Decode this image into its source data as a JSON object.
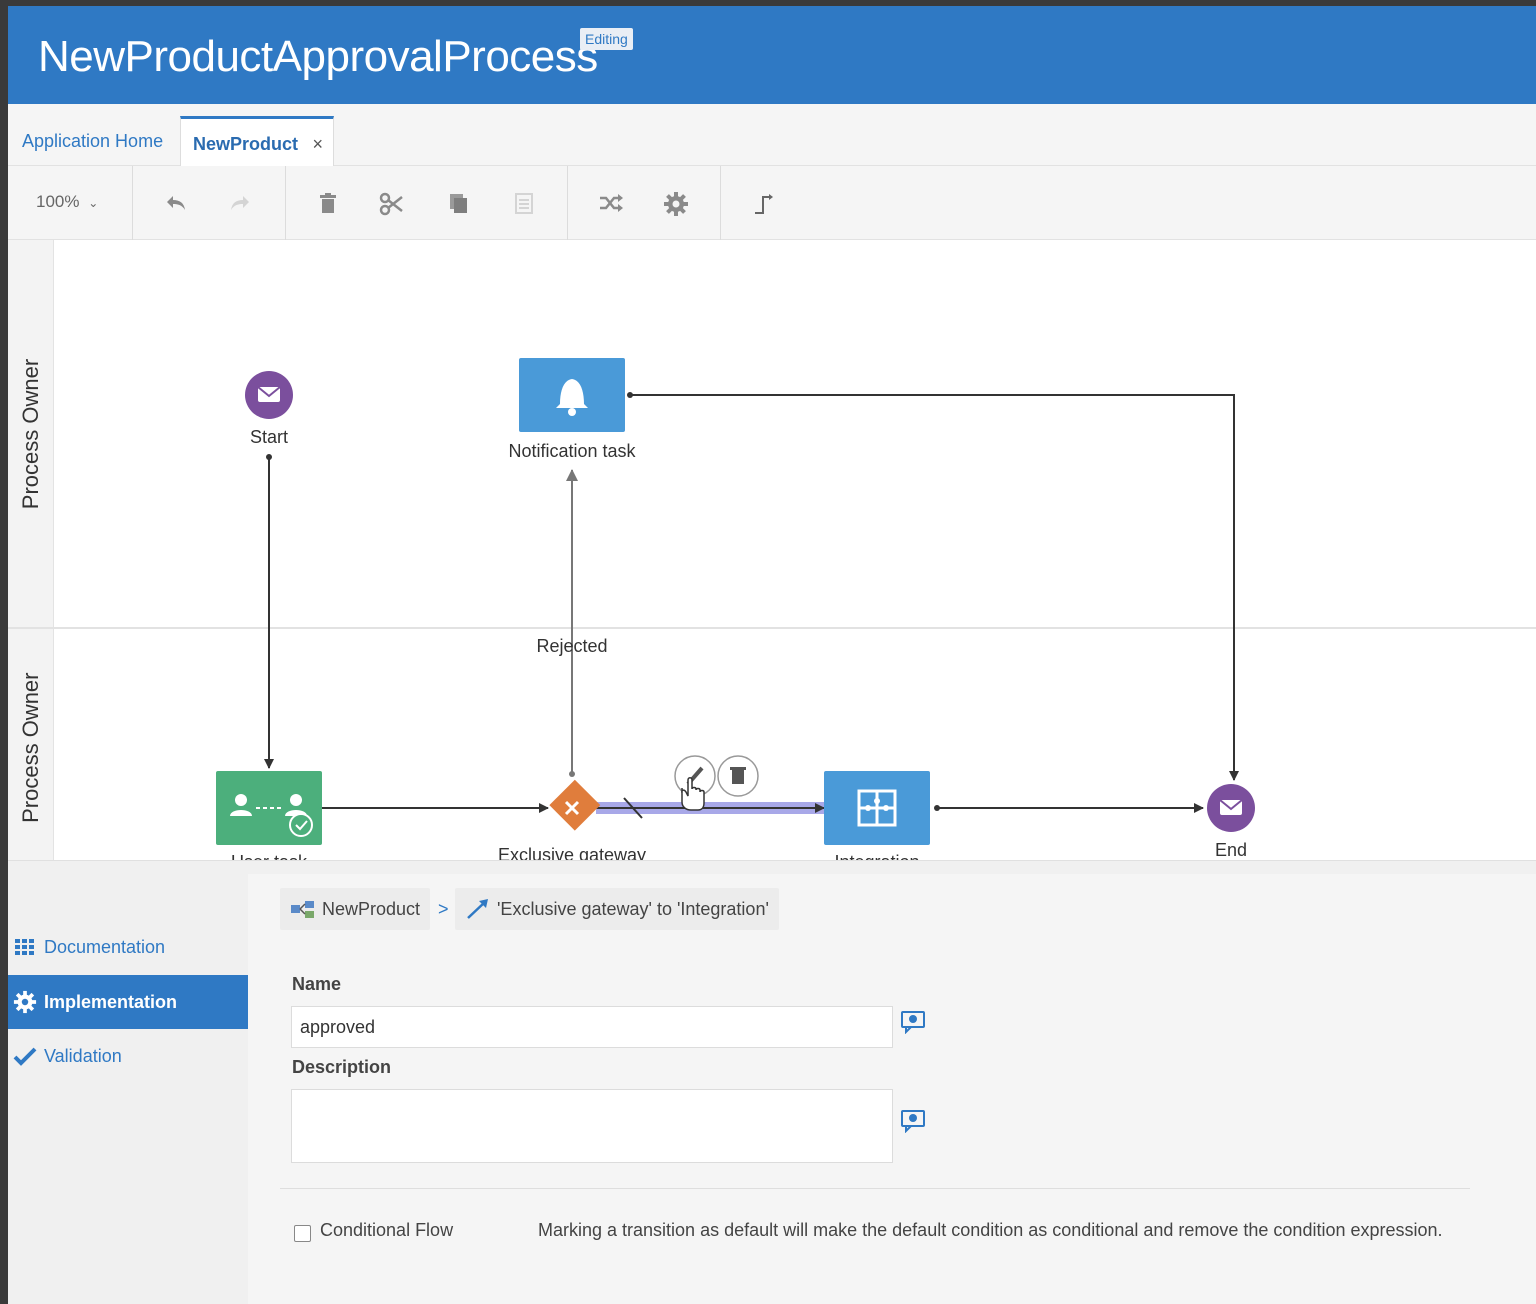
{
  "header": {
    "title": "NewProductApprovalProcess",
    "badge": "Editing"
  },
  "tabs": {
    "home_label": "Application Home",
    "active_label": "NewProduct",
    "close_glyph": "×"
  },
  "toolbar": {
    "zoom_label": "100%",
    "icons": [
      "undo-icon",
      "redo-icon",
      "trash-icon",
      "cut-icon",
      "copy-icon",
      "paste-icon",
      "shuffle-icon",
      "gear-icon",
      "connector-icon"
    ]
  },
  "canvas": {
    "lanes": [
      {
        "label": "Process Owner"
      },
      {
        "label": "Process Owner"
      }
    ],
    "nodes": {
      "start": "Start",
      "notification": "Notification task",
      "user_task": "User task",
      "gateway": "Exclusive gateway",
      "integration": "Integration",
      "end": "End"
    },
    "flow_labels": {
      "rejected": "Rejected"
    },
    "colors": {
      "event": "#7b4f9d",
      "task_blue": "#4a9ad8",
      "user_task_green": "#4caf7c",
      "gateway_orange": "#e07d3c",
      "selected_flow": "#a8a8e8"
    }
  },
  "properties": {
    "breadcrumb": {
      "root": "NewProduct",
      "separator": ">",
      "current": "'Exclusive gateway' to 'Integration'"
    },
    "side_nav": {
      "documentation": "Documentation",
      "implementation": "Implementation",
      "validation": "Validation"
    },
    "name_label": "Name",
    "name_value": "approved",
    "description_label": "Description",
    "description_value": "",
    "conditional_flow_label": "Conditional Flow",
    "conditional_flow_checked": false,
    "note": "Marking a transition as default will make the default condition as conditional and remove the condition expression."
  }
}
